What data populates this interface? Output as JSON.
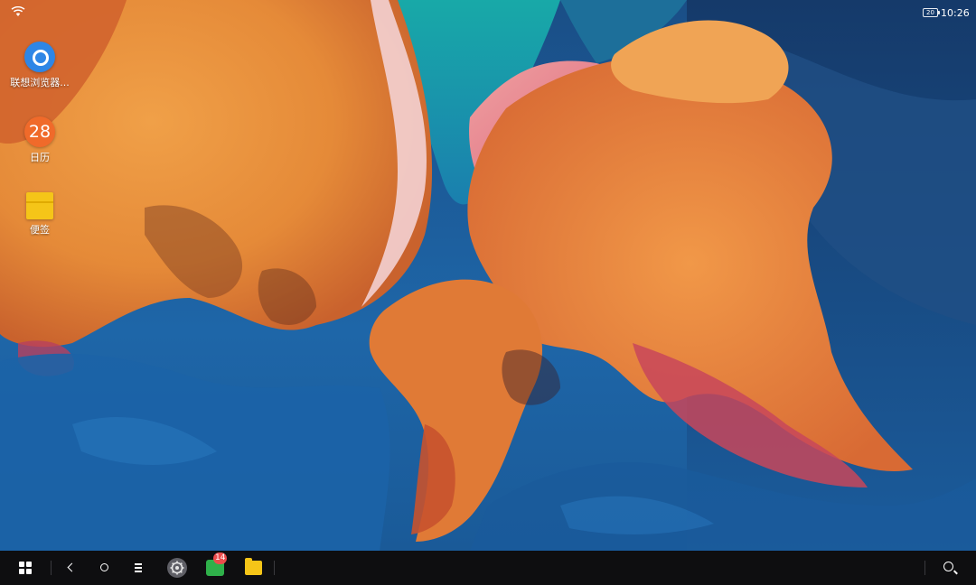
{
  "status_bar": {
    "wifi_icon": "wifi-icon",
    "battery_level": "20",
    "time": "10:26"
  },
  "desktop": {
    "icons": [
      {
        "label": "联想浏览器...",
        "icon": "browser-icon"
      },
      {
        "label": "日历",
        "icon": "calendar-icon",
        "day": "28"
      },
      {
        "label": "便签",
        "icon": "notes-icon"
      }
    ]
  },
  "taskbar": {
    "buttons": [
      {
        "icon": "start-menu-icon"
      },
      {
        "icon": "back-icon"
      },
      {
        "icon": "home-icon"
      },
      {
        "icon": "recent-apps-icon"
      },
      {
        "icon": "settings-icon"
      },
      {
        "icon": "messages-icon",
        "badge": "14"
      },
      {
        "icon": "file-manager-icon"
      },
      {
        "icon": "search-icon"
      }
    ]
  },
  "colors": {
    "taskbar_bg": "#0e0e10",
    "wallpaper_orange": "#e8893a",
    "wallpaper_blue": "#1e66a8",
    "wallpaper_teal": "#1fa3a6",
    "notes_yellow": "#f5c518",
    "calendar_orange": "#f06a2a",
    "browser_blue": "#2e86e6",
    "badge_red": "#ec4c4c"
  }
}
